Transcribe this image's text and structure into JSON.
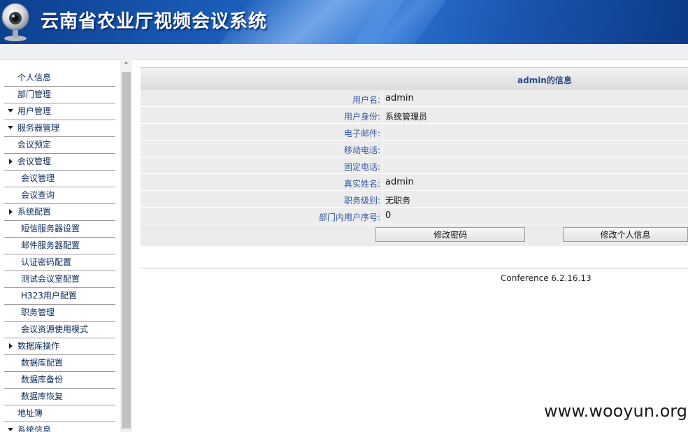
{
  "header": {
    "title": "云南省农业厅视频会议系统"
  },
  "sidebar": {
    "items": [
      {
        "label": "个人信息",
        "level": 0,
        "arrow": ""
      },
      {
        "label": "部门管理",
        "level": 0,
        "arrow": ""
      },
      {
        "label": "用户管理",
        "level": 0,
        "arrow": "down"
      },
      {
        "label": "服务器管理",
        "level": 0,
        "arrow": "down"
      },
      {
        "label": "会议预定",
        "level": 0,
        "arrow": ""
      },
      {
        "label": "会议管理",
        "level": 0,
        "arrow": "right"
      },
      {
        "label": "会议管理",
        "level": 1,
        "arrow": ""
      },
      {
        "label": "会议查询",
        "level": 1,
        "arrow": ""
      },
      {
        "label": "系统配置",
        "level": 0,
        "arrow": "right"
      },
      {
        "label": "短信服务器设置",
        "level": 1,
        "arrow": ""
      },
      {
        "label": "邮件服务器配置",
        "level": 1,
        "arrow": ""
      },
      {
        "label": "认证密码配置",
        "level": 1,
        "arrow": ""
      },
      {
        "label": "测试会议室配置",
        "level": 1,
        "arrow": ""
      },
      {
        "label": "H323用户配置",
        "level": 1,
        "arrow": ""
      },
      {
        "label": "职务管理",
        "level": 1,
        "arrow": ""
      },
      {
        "label": "会议资源使用模式",
        "level": 1,
        "arrow": ""
      },
      {
        "label": "数据库操作",
        "level": 0,
        "arrow": "right"
      },
      {
        "label": "数据库配置",
        "level": 1,
        "arrow": ""
      },
      {
        "label": "数据库备份",
        "level": 1,
        "arrow": ""
      },
      {
        "label": "数据库恢复",
        "level": 1,
        "arrow": ""
      },
      {
        "label": "地址簿",
        "level": 0,
        "arrow": ""
      },
      {
        "label": "系统信息",
        "level": 0,
        "arrow": "down"
      }
    ]
  },
  "scrollbar": {
    "up_glyph": "⌃"
  },
  "panel": {
    "title": "admin的信息",
    "rows": [
      {
        "label": "用户名:",
        "value": "admin"
      },
      {
        "label": "用户身份:",
        "value": "系统管理员"
      },
      {
        "label": "电子邮件:",
        "value": ""
      },
      {
        "label": "移动电话:",
        "value": ""
      },
      {
        "label": "固定电话:",
        "value": ""
      },
      {
        "label": "真实姓名:",
        "value": "admin"
      },
      {
        "label": "职务级别:",
        "value": "无职务"
      },
      {
        "label": "部门内用户序号:",
        "value": "0"
      }
    ],
    "buttons": {
      "change_password": "修改密码",
      "edit_profile": "修改个人信息"
    }
  },
  "footer": {
    "version": "Conference 6.2.16.13"
  },
  "watermark": "www.wooyun.org",
  "colors": {
    "header_blue": "#1c5fbd",
    "menu_text": "#0b2a5a",
    "label_blue": "#3658a2"
  },
  "icons": {
    "logo": "webcam-icon",
    "collapse": "triangle-down-icon",
    "expand": "triangle-right-icon"
  }
}
